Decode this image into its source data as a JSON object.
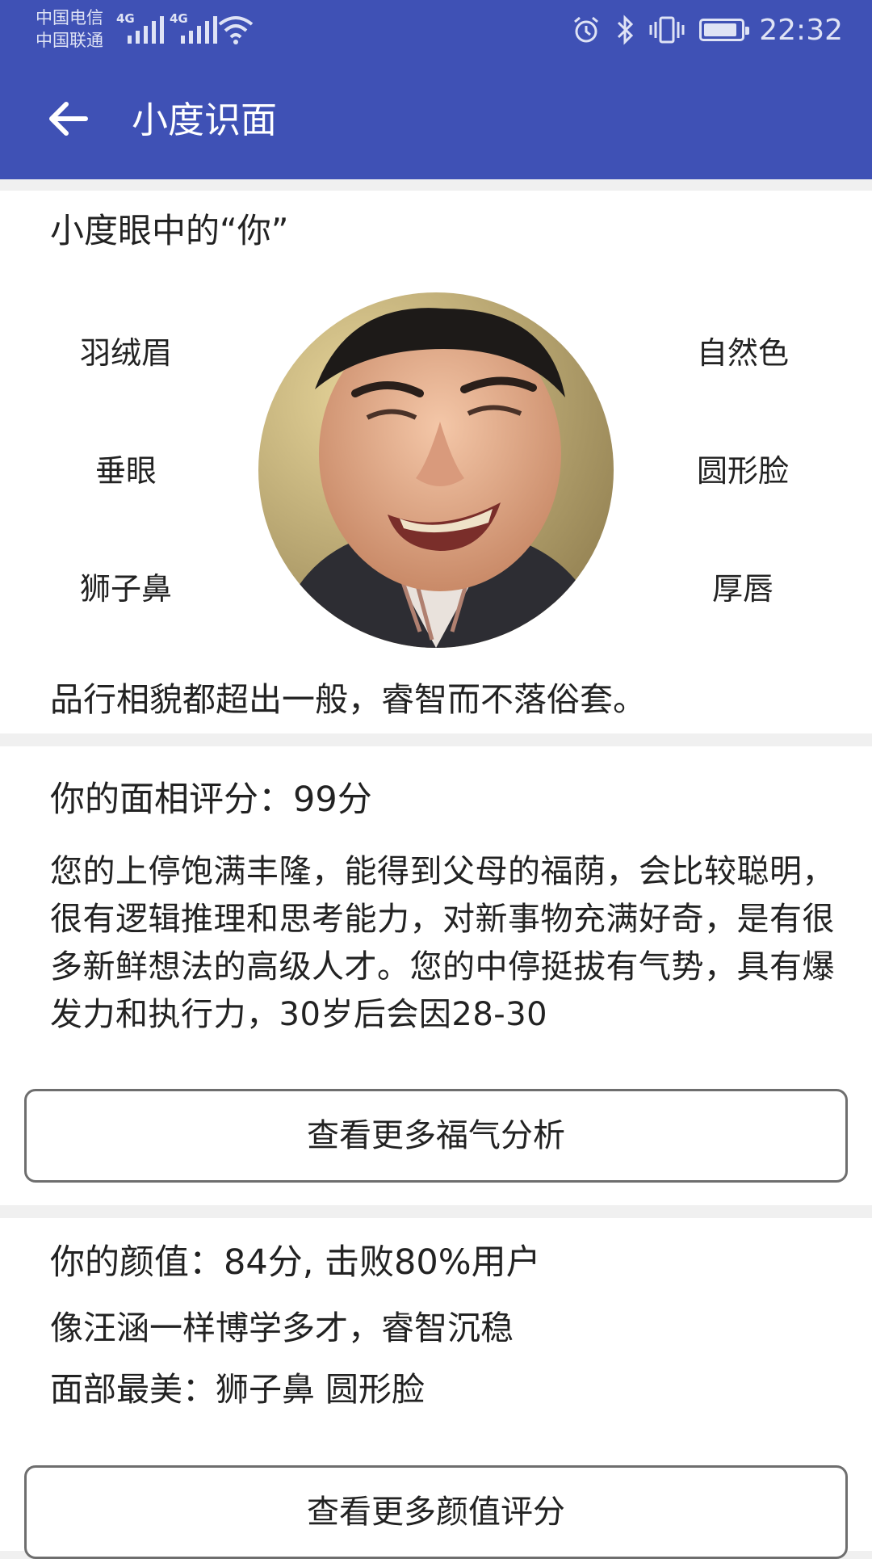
{
  "status_bar": {
    "carrier_1": "中国电信",
    "carrier_2": "中国联通",
    "network_1": "4G",
    "network_2": "4G",
    "time": "22:32",
    "icons": [
      "wifi-icon",
      "alarm-icon",
      "bluetooth-icon",
      "vibrate-icon",
      "battery-icon"
    ],
    "battery_level": 0.9
  },
  "app_bar": {
    "title": "小度识面",
    "back_icon": "arrow-left-icon"
  },
  "colors": {
    "primary": "#3f51b5",
    "background": "#f0f0f0",
    "card": "#ffffff",
    "button_border": "#6e6e6e"
  },
  "face_card": {
    "heading": "小度眼中的“你”",
    "features_left": [
      "羽绒眉",
      "垂眼",
      "狮子鼻"
    ],
    "features_right": [
      "自然色",
      "圆形脸",
      "厚唇"
    ],
    "summary": "品行相貌都超出一般，睿智而不落俗套。"
  },
  "fortune_card": {
    "score_text": "你的面相评分：99分",
    "analysis": "您的上停饱满丰隆，能得到父母的福荫，会比较聪明，很有逻辑推理和思考能力，对新事物充满好奇，是有很多新鲜想法的高级人才。您的中停挺拔有气势，具有爆发力和执行力，30岁后会因28-30",
    "button_label": "查看更多福气分析"
  },
  "beauty_card": {
    "score_text": "你的颜值：84分, 击败80%用户",
    "comparison": "像汪涵一样博学多才，睿智沉稳",
    "best_features": "面部最美：狮子鼻 圆形脸",
    "button_label": "查看更多颜值评分"
  }
}
